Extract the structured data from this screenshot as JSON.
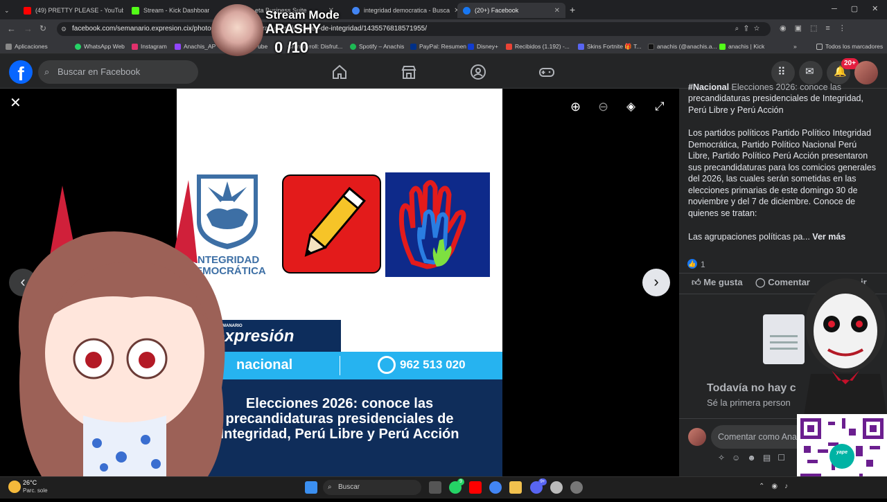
{
  "tabs": [
    {
      "title": "(49) PRETTY PLEASE - YouTube",
      "color": "#ff0000"
    },
    {
      "title": "Stream - Kick Dashboard",
      "color": "#53fc18"
    },
    {
      "title": "eta Business Suite",
      "color": "#1877f2"
    },
    {
      "title": "integridad democratica - Busca",
      "color": "#4285f4"
    },
    {
      "title": "(20+) Facebook",
      "color": "#1877f2"
    }
  ],
  "address": {
    "url": "facebook.com/semanario.expresion.cix/photos/n...recandidaturas-presidenciales-de-integridad/1435576818571955/"
  },
  "bookmarks": [
    "Aplicaciones",
    "WhatsApp Web",
    "Instagram",
    "Anachis_AP",
    "ube",
    "Crunchyroll: Disfrut...",
    "Spotify – Anachis",
    "PayPal: Resumen",
    "Disney+",
    "Recibidos (1.192) -...",
    "Skins Fortnite 🎁 T...",
    "anachis (@anachis.a...",
    "anachis | Kick",
    "Todos los marcadores"
  ],
  "stream_overlay": {
    "title": "Stream Mode",
    "name": "ARASHY",
    "score": "0 /10"
  },
  "facebook": {
    "search_placeholder": "Buscar en Facebook",
    "notif_count": "20+"
  },
  "photo": {
    "logo1_text": "INTEGRIDAD DEMOCRÁTICA",
    "brand_small": "SEMANARIO",
    "brand": "expresión",
    "section": "nacional",
    "phone": "962 513 020",
    "headline": "Elecciones 2026: conoce las precandidaturas presidenciales de Integridad, Perú Libre y Perú Acción"
  },
  "post": {
    "top_line": "Elecciones 2026: conoce las",
    "top_prefix": "#Nacional",
    "intro": "precandidaturas presidenciales de Integridad, Perú Libre y Perú Acción",
    "body": "Los partidos políticos Partido Político Integridad Democrática, Partido Político Nacional Perú Libre, Partido Político Perú Acción presentaron sus precandidaturas para los comicios generales del 2026, las cuales serán sometidas en las elecciones primarias de este domingo 30 de noviembre y del 7 de diciembre. Conoce de quienes se tratan:",
    "truncated": "Las agrupaciones políticas pa...",
    "see_more": "Ver más",
    "reactions": "1",
    "like": "Me gusta",
    "comment": "Comentar",
    "share": "ir",
    "no_comments": "Todavía no hay c",
    "be_first": "Sé la primera person",
    "comment_placeholder": "Comentar como Ana"
  },
  "qr_label": "yape",
  "weather": {
    "temp": "26°C",
    "desc": "Parc. sole"
  },
  "taskbar": {
    "search": "Buscar",
    "badge1": "9",
    "badge2": "9+"
  }
}
